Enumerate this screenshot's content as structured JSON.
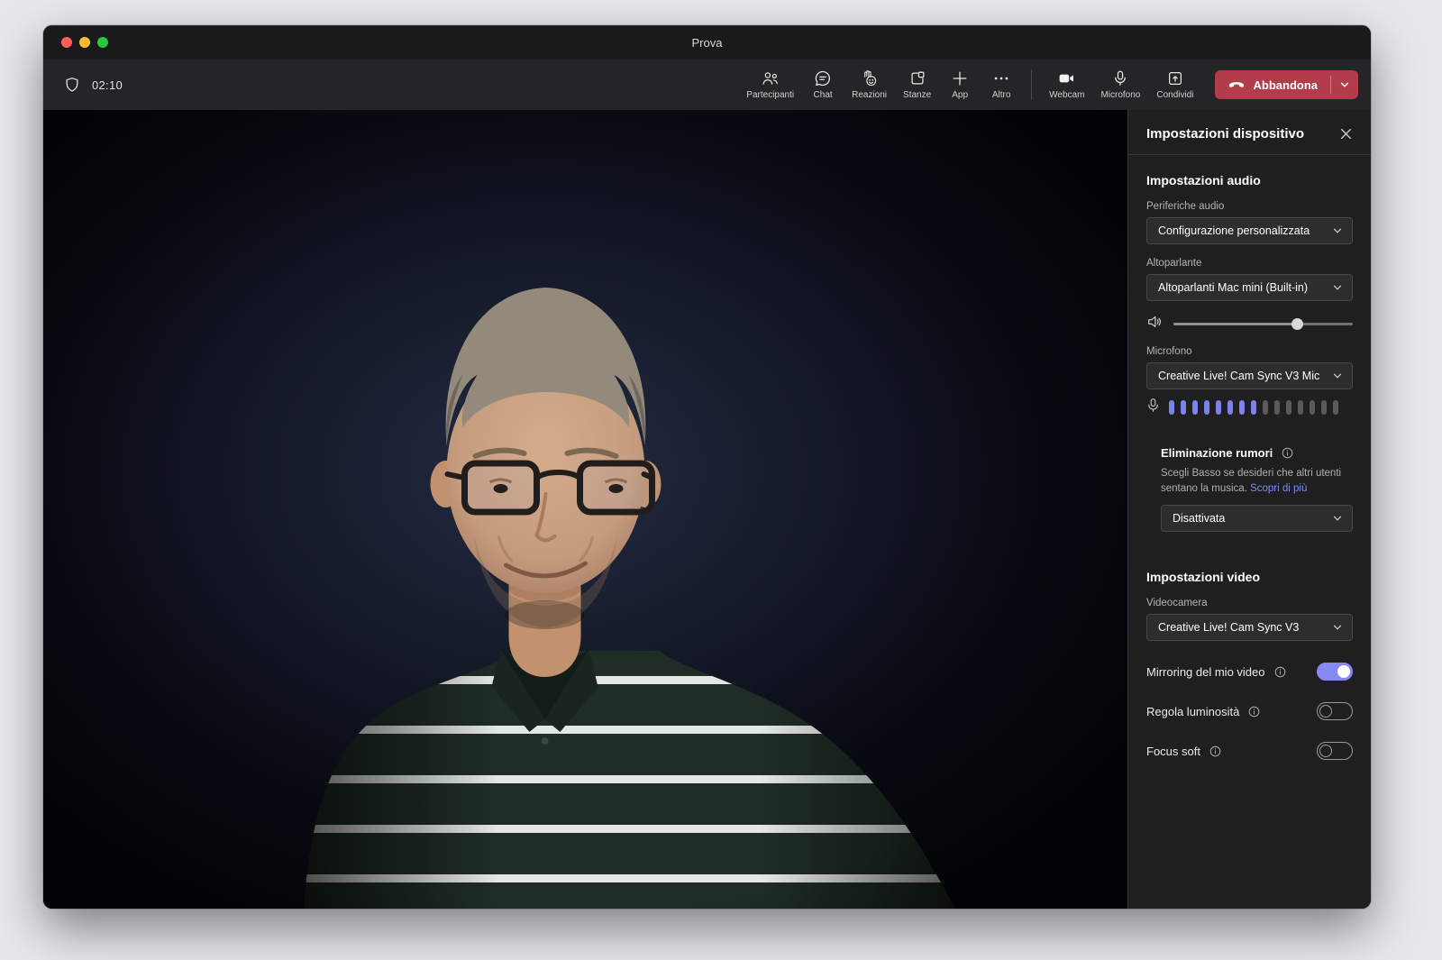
{
  "window": {
    "title": "Prova"
  },
  "meeting": {
    "timer": "02:10"
  },
  "toolbar": {
    "buttons": [
      {
        "label": "Partecipanti"
      },
      {
        "label": "Chat"
      },
      {
        "label": "Reazioni"
      },
      {
        "label": "Stanze"
      },
      {
        "label": "App"
      },
      {
        "label": "Altro"
      }
    ],
    "device_buttons": [
      {
        "label": "Webcam"
      },
      {
        "label": "Microfono"
      },
      {
        "label": "Condividi"
      }
    ],
    "leave": {
      "label": "Abbandona"
    }
  },
  "panel": {
    "title": "Impostazioni dispositivo",
    "audio": {
      "section_title": "Impostazioni audio",
      "devices_label": "Periferiche audio",
      "devices_value": "Configurazione personalizzata",
      "speaker_label": "Altoparlante",
      "speaker_value": "Altoparlanti Mac mini (Built-in)",
      "volume_pct": 69,
      "mic_label": "Microfono",
      "mic_value": "Creative Live! Cam Sync V3 Mic",
      "mic_meter": {
        "total": 15,
        "active": 8
      },
      "noise": {
        "title": "Eliminazione rumori",
        "description": "Scegli Basso se desideri che altri utenti sentano la musica.",
        "link": "Scopri di più",
        "value": "Disattivata"
      }
    },
    "video": {
      "section_title": "Impostazioni video",
      "camera_label": "Videocamera",
      "camera_value": "Creative Live! Cam Sync V3",
      "toggles": [
        {
          "label": "Mirroring del mio video",
          "on": true
        },
        {
          "label": "Regola luminosità",
          "on": false
        },
        {
          "label": "Focus soft",
          "on": false
        }
      ]
    }
  },
  "colors": {
    "accent": "#7b83ee",
    "danger": "#b23c4b",
    "toggle_on": "#8589f2"
  }
}
